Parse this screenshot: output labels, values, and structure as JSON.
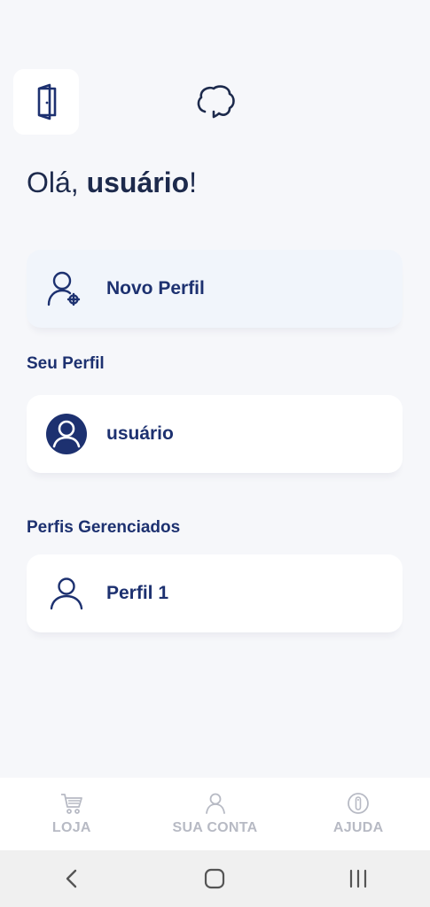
{
  "header": {
    "logout_icon": "door-exit-icon",
    "brain_icon": "brain-icon"
  },
  "greeting": {
    "prefix": "Olá, ",
    "name": "usuário",
    "suffix": "!"
  },
  "new_profile": {
    "label": "Novo Perfil",
    "icon": "user-add-icon"
  },
  "your_profile": {
    "title": "Seu Perfil",
    "name": "usuário",
    "icon": "user-avatar-filled-icon"
  },
  "managed_profiles": {
    "title": "Perfis Gerenciados",
    "items": [
      {
        "name": "Perfil 1",
        "icon": "user-outline-icon"
      }
    ]
  },
  "bottom_nav": {
    "items": [
      {
        "label": "LOJA",
        "icon": "cart-icon"
      },
      {
        "label": "SUA CONTA",
        "icon": "user-icon"
      },
      {
        "label": "AJUDA",
        "icon": "info-icon"
      }
    ]
  },
  "system_nav": {
    "items": [
      "back-icon",
      "home-icon",
      "recents-icon"
    ]
  },
  "colors": {
    "primary": "#1d3170",
    "muted": "#b7bac4",
    "background": "#f6f7fa",
    "card": "#ffffff",
    "card_highlight": "#f1f5fb"
  }
}
